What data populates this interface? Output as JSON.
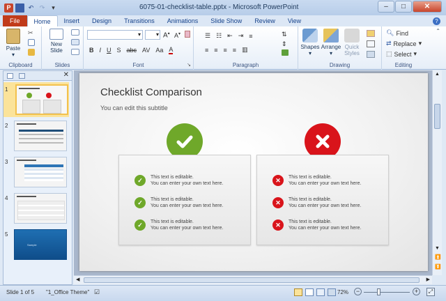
{
  "window": {
    "title": "6075-01-checklist-table.pptx - Microsoft PowerPoint",
    "qat_icons": [
      "powerpoint-icon",
      "save-icon",
      "undo-icon",
      "redo-icon",
      "customize-icon"
    ]
  },
  "tabs": [
    "File",
    "Home",
    "Insert",
    "Design",
    "Transitions",
    "Animations",
    "Slide Show",
    "Review",
    "View"
  ],
  "active_tab": "Home",
  "ribbon": {
    "clipboard": {
      "label": "Clipboard",
      "paste": "Paste"
    },
    "slides": {
      "label": "Slides",
      "new_slide": "New\nSlide"
    },
    "font": {
      "label": "Font",
      "styles": [
        "B",
        "I",
        "U",
        "S",
        "abc",
        "AV",
        "Aa",
        "A"
      ]
    },
    "paragraph": {
      "label": "Paragraph"
    },
    "drawing": {
      "label": "Drawing",
      "shapes": "Shapes",
      "arrange": "Arrange",
      "quick_styles": "Quick\nStyles"
    },
    "editing": {
      "label": "Editing",
      "find": "Find",
      "replace": "Replace",
      "select": "Select"
    }
  },
  "thumbnails": [
    "1",
    "2",
    "3",
    "4",
    "5"
  ],
  "slide": {
    "title": "Checklist Comparison",
    "subtitle": "You can edit this subtitle",
    "left_rows": [
      {
        "line1": "This text is editable.",
        "line2": "You can enter your own text here."
      },
      {
        "line1": "This text is editable.",
        "line2": "You can enter your own text here."
      },
      {
        "line1": "This text is editable.",
        "line2": "You can enter your own text here."
      }
    ],
    "right_rows": [
      {
        "line1": "This text is editable.",
        "line2": "You can enter your own text here."
      },
      {
        "line1": "This text is editable.",
        "line2": "You can enter your own text here."
      },
      {
        "line1": "This text is editable.",
        "line2": "You can enter your own text here."
      }
    ],
    "check_color": "#6fa82a",
    "cross_color": "#d9141b"
  },
  "status": {
    "slide_info": "Slide 1 of 5",
    "theme": "\"1_Office Theme\"",
    "zoom": "72%"
  },
  "thumb5_text": "Sample"
}
